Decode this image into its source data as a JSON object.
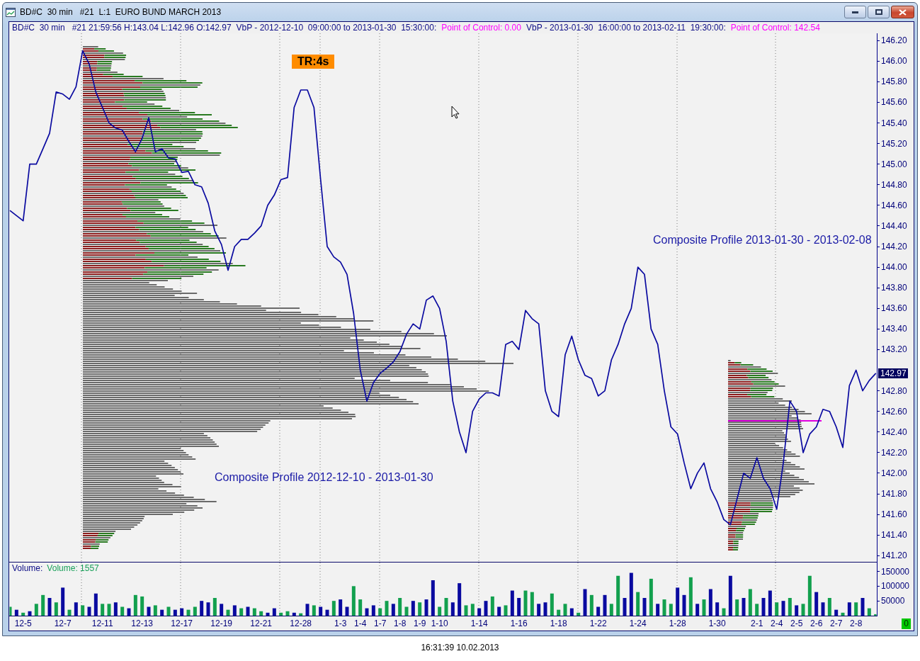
{
  "window": {
    "title": "BD#C  30 min   #21  L:1  EURO BUND MARCH 2013"
  },
  "header": [
    {
      "kind": "info",
      "text": "BD#C  30 min   #21 21:59:56 H:143.04 L:142.96 O:142.97"
    },
    {
      "kind": "info",
      "text": "VbP - 2012-12-10  09:00:00 to 2013-01-30  15:30:00:"
    },
    {
      "kind": "poc",
      "text": "Point of Control: 0.00"
    },
    {
      "kind": "info",
      "text": "VbP - 2013-01-30  16:00:00 to 2013-02-11  19:30:00:"
    },
    {
      "kind": "poc",
      "text": "Point of Control: 142.54"
    }
  ],
  "chart": {
    "timer_badge": "TR:4s",
    "last_price": "142.97",
    "volume_title": "Volume:",
    "volume_reading": "Volume: 1557",
    "chart_data": [
      {
        "type": "line",
        "color": "#0a0aa0",
        "grid": true,
        "ylim": [
          141.14,
          146.27
        ],
        "yticks": [
          {
            "value": 141.2,
            "label": "141.20"
          },
          {
            "value": 141.4,
            "label": "141.40"
          },
          {
            "value": 141.6,
            "label": "141.60"
          },
          {
            "value": 141.8,
            "label": "141.80"
          },
          {
            "value": 142.0,
            "label": "142.00"
          },
          {
            "value": 142.2,
            "label": "142.20"
          },
          {
            "value": 142.4,
            "label": "142.40"
          },
          {
            "value": 142.6,
            "label": "142.60"
          },
          {
            "value": 142.8,
            "label": "142.80"
          },
          {
            "value": 143.2,
            "label": "143.20"
          },
          {
            "value": 143.4,
            "label": "143.40"
          },
          {
            "value": 143.6,
            "label": "143.60"
          },
          {
            "value": 143.8,
            "label": "143.80"
          },
          {
            "value": 144.0,
            "label": "144.00"
          },
          {
            "value": 144.2,
            "label": "144.20"
          },
          {
            "value": 144.4,
            "label": "144.40"
          },
          {
            "value": 144.6,
            "label": "144.60"
          },
          {
            "value": 144.8,
            "label": "144.80"
          },
          {
            "value": 145.0,
            "label": "145.00"
          },
          {
            "value": 145.2,
            "label": "145.20"
          },
          {
            "value": 145.4,
            "label": "145.40"
          },
          {
            "value": 145.6,
            "label": "145.60"
          },
          {
            "value": 145.8,
            "label": "145.80"
          },
          {
            "value": 146.0,
            "label": "146.00"
          },
          {
            "value": 146.2,
            "label": "146.20"
          }
        ],
        "values": [
          144.55,
          144.5,
          144.45,
          145.0,
          145.0,
          145.15,
          145.3,
          145.7,
          145.68,
          145.63,
          145.75,
          146.1,
          145.97,
          145.7,
          145.55,
          145.4,
          145.35,
          145.33,
          145.22,
          145.12,
          145.25,
          145.45,
          145.12,
          145.15,
          145.06,
          145.05,
          144.92,
          144.93,
          144.8,
          144.78,
          144.62,
          144.35,
          144.22,
          143.97,
          144.2,
          144.27,
          144.27,
          144.33,
          144.4,
          144.6,
          144.7,
          144.85,
          144.87,
          145.55,
          145.72,
          145.72,
          145.55,
          144.85,
          144.2,
          144.1,
          144.05,
          143.93,
          143.55,
          143.0,
          142.7,
          142.88,
          142.97,
          143.02,
          143.08,
          143.18,
          143.35,
          143.45,
          143.4,
          143.68,
          143.72,
          143.6,
          143.28,
          142.7,
          142.4,
          142.2,
          142.6,
          142.72,
          142.78,
          142.78,
          142.75,
          143.25,
          143.28,
          143.2,
          143.58,
          143.5,
          143.45,
          142.8,
          142.6,
          142.55,
          143.15,
          143.33,
          143.1,
          142.95,
          142.92,
          142.75,
          142.8,
          143.1,
          143.25,
          143.45,
          143.6,
          144.0,
          143.93,
          143.4,
          143.25,
          142.8,
          142.45,
          142.38,
          142.1,
          141.85,
          142.0,
          142.1,
          141.85,
          141.72,
          141.55,
          141.5,
          141.75,
          142.0,
          141.95,
          142.15,
          141.95,
          141.85,
          141.65,
          142.1,
          142.7,
          142.6,
          142.2,
          142.38,
          142.45,
          142.62,
          142.6,
          142.45,
          142.25,
          142.85,
          143.0,
          142.8,
          142.9,
          142.97
        ],
        "annotations": [
          "Composite Profile 2012-12-10 - 2013-01-30",
          "Composite Profile 2013-01-30 - 2013-02-08"
        ]
      },
      {
        "type": "bar",
        "grid": true,
        "ylim": [
          0,
          180000
        ],
        "yticks": [
          50000,
          100000,
          150000
        ],
        "categories": [
          null,
          null,
          "12-5",
          null,
          null,
          null,
          null,
          null,
          "12-7",
          null,
          null,
          null,
          null,
          null,
          "12-11",
          null,
          null,
          null,
          null,
          null,
          "12-13",
          null,
          null,
          null,
          null,
          null,
          "12-17",
          null,
          null,
          null,
          null,
          null,
          "12-19",
          null,
          null,
          null,
          null,
          null,
          "12-21",
          null,
          null,
          null,
          null,
          null,
          "12-28",
          null,
          null,
          null,
          null,
          null,
          "1-3",
          null,
          null,
          "1-4",
          null,
          null,
          "1-7",
          null,
          null,
          "1-8",
          null,
          null,
          "1-9",
          null,
          null,
          "1-10",
          null,
          null,
          null,
          null,
          null,
          "1-14",
          null,
          null,
          null,
          null,
          null,
          "1-16",
          null,
          null,
          null,
          null,
          null,
          "1-18",
          null,
          null,
          null,
          null,
          null,
          "1-22",
          null,
          null,
          null,
          null,
          null,
          "1-24",
          null,
          null,
          null,
          null,
          null,
          "1-28",
          null,
          null,
          null,
          null,
          null,
          "1-30",
          null,
          null,
          null,
          null,
          null,
          "2-1",
          null,
          null,
          "2-4",
          null,
          null,
          "2-5",
          null,
          null,
          "2-6",
          null,
          null,
          "2-7",
          null,
          null,
          "2-8",
          null,
          null,
          null
        ],
        "values": [
          30000,
          20000,
          10000,
          15000,
          40000,
          70000,
          60000,
          45000,
          95000,
          20000,
          45000,
          35000,
          30000,
          75000,
          40000,
          40000,
          45000,
          30000,
          25000,
          70000,
          65000,
          30000,
          35000,
          20000,
          30000,
          20000,
          25000,
          20000,
          30000,
          50000,
          45000,
          60000,
          40000,
          20000,
          35000,
          25000,
          30000,
          25000,
          15000,
          10000,
          25000,
          10000,
          15000,
          10000,
          8000,
          40000,
          35000,
          30000,
          20000,
          50000,
          55000,
          30000,
          100000,
          55000,
          25000,
          35000,
          25000,
          50000,
          40000,
          60000,
          30000,
          50000,
          45000,
          55000,
          120000,
          30000,
          60000,
          45000,
          110000,
          35000,
          40000,
          25000,
          50000,
          65000,
          30000,
          35000,
          85000,
          60000,
          85000,
          80000,
          40000,
          45000,
          75000,
          20000,
          40000,
          25000,
          10000,
          90000,
          70000,
          30000,
          70000,
          40000,
          135000,
          60000,
          145000,
          80000,
          60000,
          125000,
          40000,
          55000,
          40000,
          95000,
          70000,
          130000,
          40000,
          55000,
          90000,
          45000,
          25000,
          135000,
          55000,
          60000,
          90000,
          40000,
          60000,
          85000,
          45000,
          50000,
          60000,
          35000,
          40000,
          135000,
          80000,
          45000,
          60000,
          20000,
          10000,
          45000,
          45000,
          60000,
          25000,
          5000
        ],
        "colors": [
          "#12a04e",
          "#0a0aa0",
          "#12a04e",
          "#0a0aa0",
          "#12a04e",
          "#12a04e",
          "#0a0aa0",
          "#12a04e",
          "#0a0aa0",
          "#12a04e",
          "#0a0aa0",
          "#12a04e",
          "#0a0aa0",
          "#0a0aa0",
          "#12a04e",
          "#12a04e",
          "#0a0aa0",
          "#12a04e",
          "#0a0aa0",
          "#12a04e",
          "#12a04e",
          "#0a0aa0",
          "#12a04e",
          "#0a0aa0",
          "#12a04e",
          "#0a0aa0",
          "#0a0aa0",
          "#12a04e",
          "#12a04e",
          "#0a0aa0",
          "#0a0aa0",
          "#12a04e",
          "#0a0aa0",
          "#12a04e",
          "#0a0aa0",
          "#12a04e",
          "#0a0aa0",
          "#12a04e",
          "#12a04e",
          "#0a0aa0",
          "#0a0aa0",
          "#12a04e",
          "#12a04e",
          "#0a0aa0",
          "#12a04e",
          "#0a0aa0",
          "#12a04e",
          "#0a0aa0",
          "#0a0aa0",
          "#12a04e",
          "#0a0aa0",
          "#0a0aa0",
          "#12a04e",
          "#12a04e",
          "#0a0aa0",
          "#0a0aa0",
          "#12a04e",
          "#12a04e",
          "#0a0aa0",
          "#12a04e",
          "#12a04e",
          "#0a0aa0",
          "#12a04e",
          "#0a0aa0",
          "#0a0aa0",
          "#12a04e",
          "#12a04e",
          "#0a0aa0",
          "#0a0aa0",
          "#12a04e",
          "#12a04e",
          "#0a0aa0",
          "#0a0aa0",
          "#12a04e",
          "#0a0aa0",
          "#12a04e",
          "#0a0aa0",
          "#0a0aa0",
          "#12a04e",
          "#12a04e",
          "#0a0aa0",
          "#0a0aa0",
          "#12a04e",
          "#12a04e",
          "#12a04e",
          "#0a0aa0",
          "#12a04e",
          "#0a0aa0",
          "#12a04e",
          "#0a0aa0",
          "#0a0aa0",
          "#12a04e",
          "#12a04e",
          "#0a0aa0",
          "#0a0aa0",
          "#12a04e",
          "#0a0aa0",
          "#12a04e",
          "#0a0aa0",
          "#12a04e",
          "#12a04e",
          "#0a0aa0",
          "#0a0aa0",
          "#12a04e",
          "#0a0aa0",
          "#12a04e",
          "#0a0aa0",
          "#0a0aa0",
          "#12a04e",
          "#0a0aa0",
          "#12a04e",
          "#0a0aa0",
          "#12a04e",
          "#12a04e",
          "#0a0aa0",
          "#0a0aa0",
          "#12a04e",
          "#0a0aa0",
          "#12a04e",
          "#0a0aa0",
          "#12a04e",
          "#12a04e",
          "#0a0aa0",
          "#0a0aa0",
          "#12a04e",
          "#0a0aa0",
          "#12a04e",
          "#0a0aa0",
          "#12a04e",
          "#0a0aa0",
          "#12a04e",
          "#12a04e"
        ]
      }
    ]
  },
  "status_indicator": "0",
  "timestamp": "16:31:39 10.02.2013"
}
